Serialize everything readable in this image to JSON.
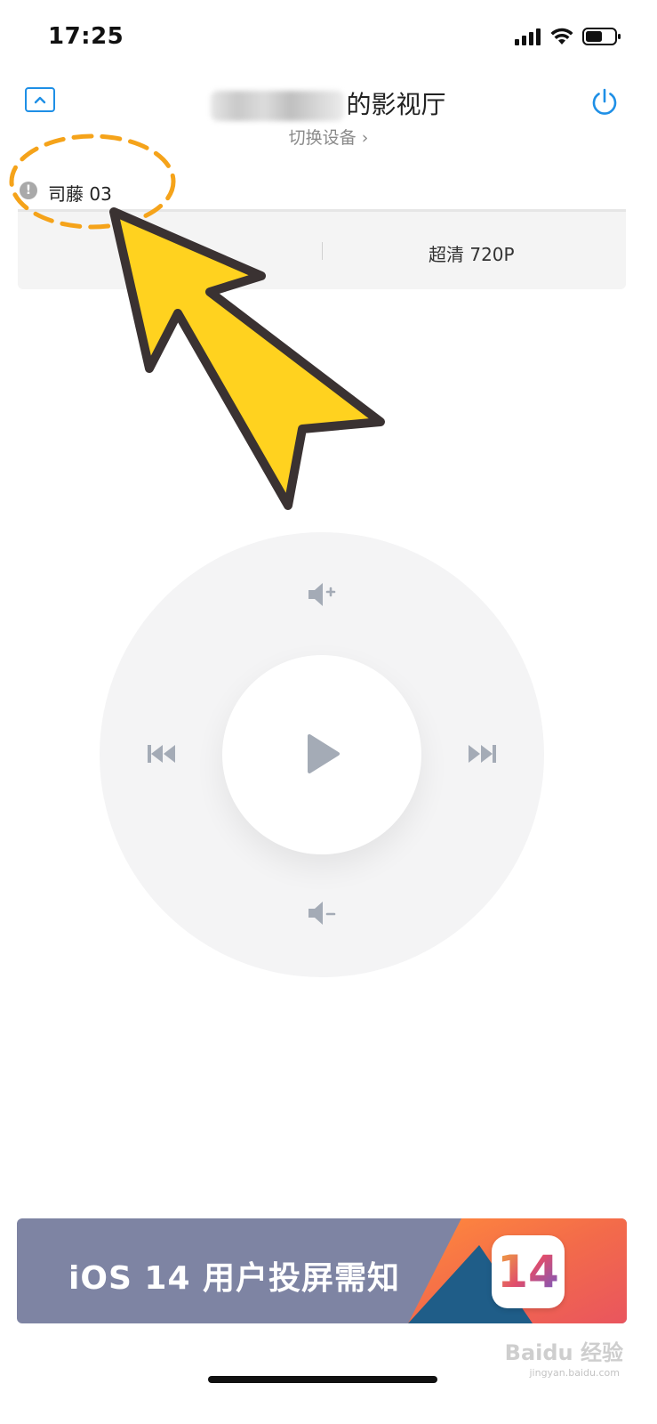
{
  "status_bar": {
    "time": "17:25"
  },
  "header": {
    "title_suffix": "的影视厅",
    "switch_device_label": "切换设备",
    "switch_device_chevron": "›"
  },
  "media": {
    "info_glyph": "!",
    "title": "司藤 03",
    "quality": "超清 720P"
  },
  "remote": {
    "volume_up": "volume-up-icon",
    "volume_down": "volume-down-icon",
    "previous": "previous-track-icon",
    "next": "next-track-icon",
    "play": "play-icon"
  },
  "banner": {
    "text": "iOS 14 用户投屏需知",
    "badge": "14"
  },
  "watermark": {
    "logo": "Baidu 经验",
    "site": "jingyan.baidu.com"
  },
  "colors": {
    "accent": "#1e8fe6",
    "annotation_outline": "#f5a31a",
    "annotation_arrow": "#ffd21f",
    "control_icon": "#a4abb6",
    "banner_bg": "#7e84a3"
  }
}
